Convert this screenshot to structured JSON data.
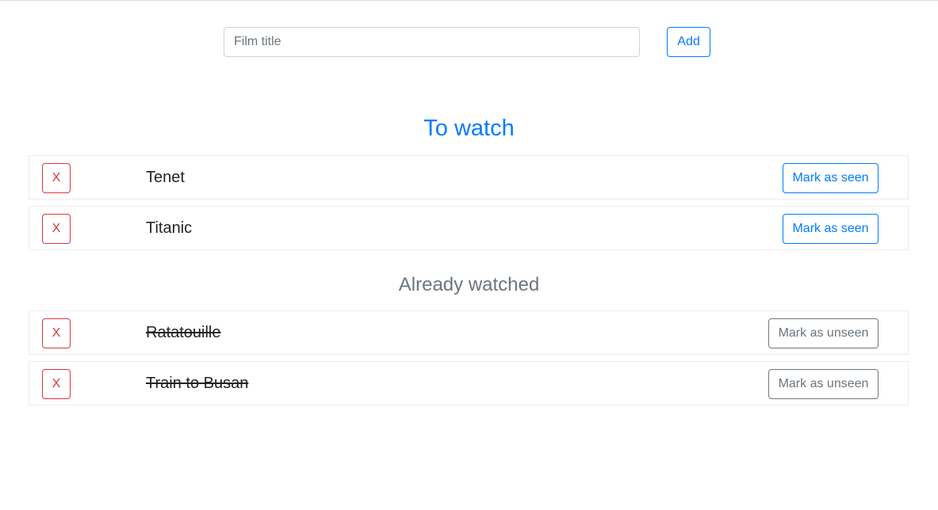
{
  "add_form": {
    "input_placeholder": "Film title",
    "input_value": "",
    "add_label": "Add"
  },
  "to_watch": {
    "heading": "To watch",
    "films": [
      {
        "title": "Tenet",
        "remove_label": "X",
        "action_label": "Mark as seen"
      },
      {
        "title": "Titanic",
        "remove_label": "X",
        "action_label": "Mark as seen"
      }
    ]
  },
  "watched": {
    "heading": "Already watched",
    "films": [
      {
        "title": "Ratatouille",
        "remove_label": "X",
        "action_label": "Mark as unseen"
      },
      {
        "title": "Train to Busan",
        "remove_label": "X",
        "action_label": "Mark as unseen"
      }
    ]
  },
  "colors": {
    "primary": "#007bff",
    "danger": "#dc3545",
    "secondary": "#6c757d"
  }
}
